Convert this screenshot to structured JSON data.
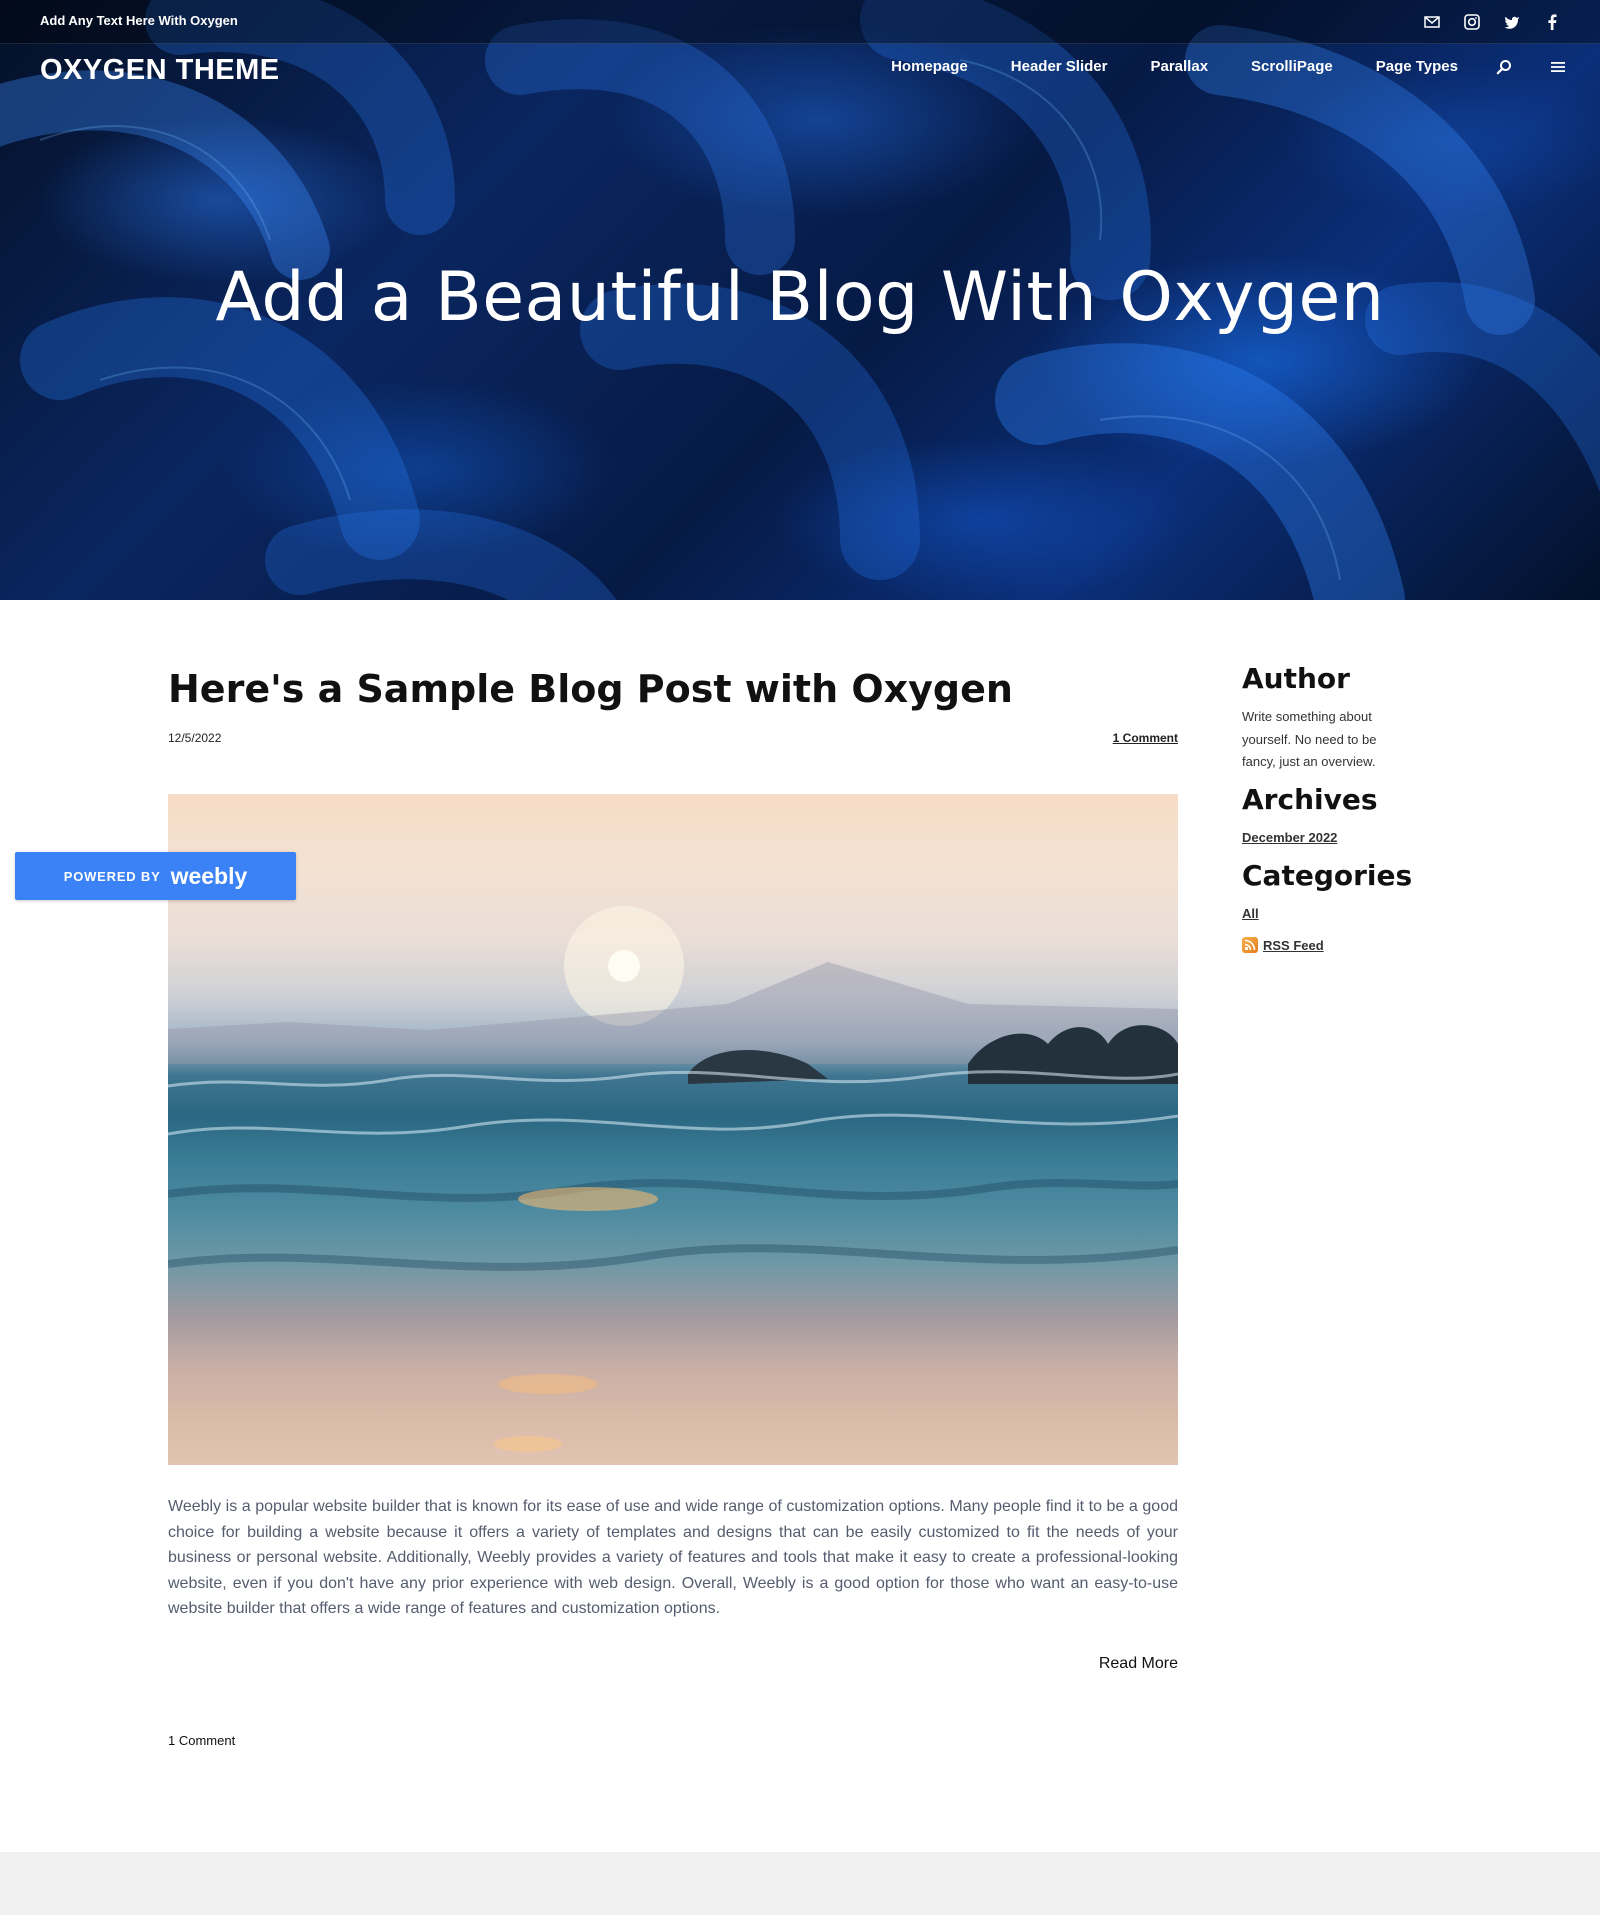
{
  "topbar": {
    "text": "Add Any Text Here With Oxygen",
    "social_icons": [
      "mail-icon",
      "instagram-icon",
      "twitter-icon",
      "facebook-icon"
    ]
  },
  "header": {
    "logo": "OXYGEN THEME",
    "nav": [
      "Homepage",
      "Header Slider",
      "Parallax",
      "ScrolliPage",
      "Page Types"
    ],
    "nav_icons": [
      "search-icon",
      "menu-icon"
    ]
  },
  "hero": {
    "title": "Add a Beautiful Blog With Oxygen"
  },
  "post": {
    "title": "Here's a Sample Blog Post with Oxygen",
    "date": "12/5/2022",
    "comment_link": "1 Comment",
    "body": "Weebly is a popular website builder that is known for its ease of use and wide range of customization options. Many people find it to be a good choice for building a website because it offers a variety of templates and designs that can be easily customized to fit the needs of your business or personal website. Additionally, Weebly provides a variety of features and tools that make it easy to create a professional-looking website, even if you don't have any prior experience with web design. Overall, Weebly is a good option for those who want an easy-to-use website builder that offers a wide range of features and customization options.",
    "read_more": "Read More",
    "comments_count": "1 Comment"
  },
  "sidebar": {
    "author_heading": "Author",
    "author_text": "Write something about yourself. No need to be fancy, just an overview.",
    "archives_heading": "Archives",
    "archive_link": "December 2022",
    "categories_heading": "Categories",
    "category_link": "All",
    "rss_link": "RSS Feed"
  },
  "badge": {
    "powered_by": "POWERED BY",
    "brand": "weebly"
  },
  "colors": {
    "badge": "#3b82f6",
    "hero_dark": "#061a45",
    "hero_accent": "#1e6fe0",
    "body_text": "#555c6e",
    "footer": "#f1f1f1"
  }
}
